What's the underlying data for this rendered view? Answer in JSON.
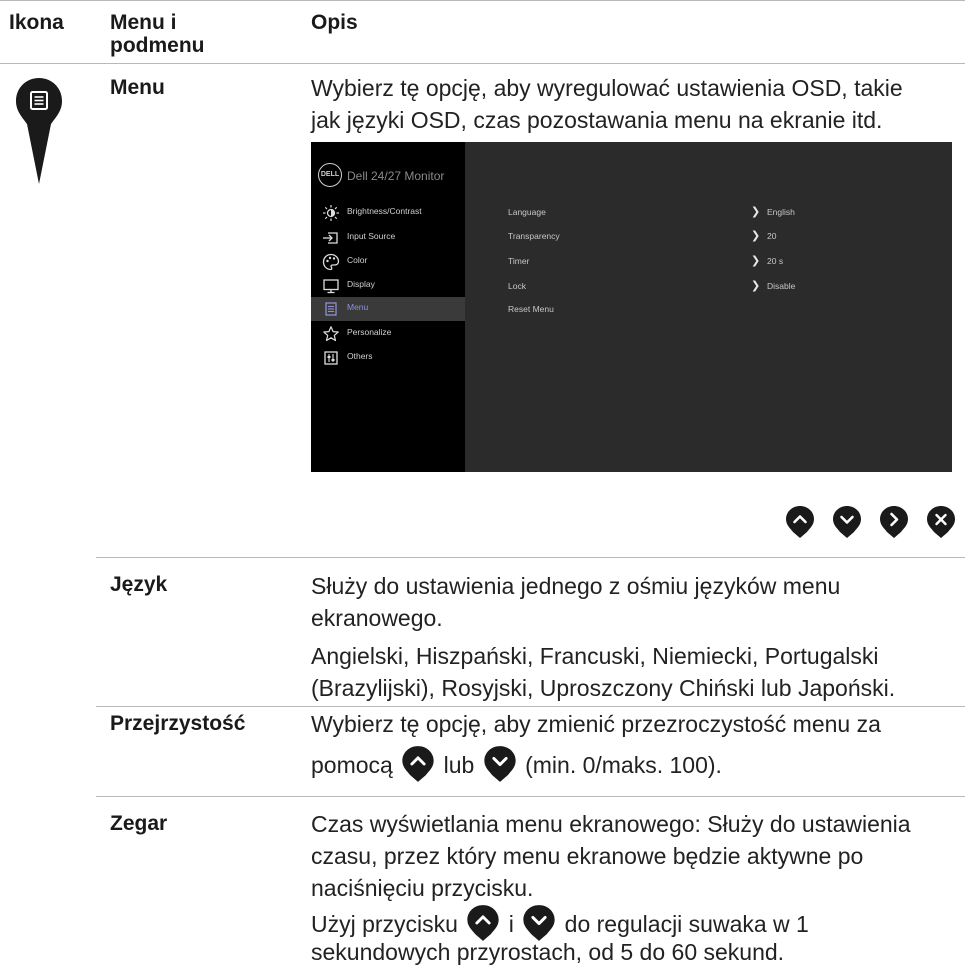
{
  "header": {
    "col_icon": "Ikona",
    "col_menu_line1": "Menu i",
    "col_menu_line2": "podmenu",
    "col_desc": "Opis"
  },
  "menu_row": {
    "term": "Menu",
    "description_line1": "Wybierz tę opcję, aby wyregulować ustawienia OSD, takie",
    "description_line2": "jak języki OSD, czas pozostawania menu na ekranie itd."
  },
  "osd": {
    "logo": "DELL",
    "title": "Dell 24/27 Monitor",
    "sidebar": [
      {
        "label": "Brightness/Contrast",
        "icon": "brightness-icon"
      },
      {
        "label": "Input Source",
        "icon": "input-source-icon"
      },
      {
        "label": "Color",
        "icon": "color-palette-icon"
      },
      {
        "label": "Display",
        "icon": "display-icon"
      },
      {
        "label": "Menu",
        "icon": "menu-icon",
        "selected": true
      },
      {
        "label": "Personalize",
        "icon": "star-icon"
      },
      {
        "label": "Others",
        "icon": "others-icon"
      }
    ],
    "settings": [
      {
        "label": "Language",
        "value": "English"
      },
      {
        "label": "Transparency",
        "value": "20"
      },
      {
        "label": "Timer",
        "value": "20 s"
      },
      {
        "label": "Lock",
        "value": "Disable"
      },
      {
        "label": "Reset Menu",
        "value": ""
      }
    ]
  },
  "nav_buttons": [
    "up-button-icon",
    "down-button-icon",
    "right-button-icon",
    "close-button-icon"
  ],
  "language": {
    "term": "Język",
    "description_line1": "Służy do ustawienia jednego z ośmiu języków menu",
    "description_line2": "ekranowego.",
    "list_line1": "Angielski, Hiszpański, Francuski, Niemiecki, Portugalski",
    "list_line2": "(Brazylijski), Rosyjski, Uproszczony Chiński lub Japoński."
  },
  "transparency": {
    "term": "Przejrzystość",
    "description_line1": "Wybierz tę opcję, aby zmienić przezroczystość menu za",
    "description_pre": "pomocą",
    "description_mid": "lub",
    "description_post": "(min. 0/maks. 100)."
  },
  "timer": {
    "term": "Zegar",
    "description_line1": "Czas wyświetlania menu ekranowego: Służy do ustawienia",
    "description_line2": "czasu, przez który menu ekranowe będzie aktywne po",
    "description_line3": "naciśnięciu przycisku.",
    "usage_pre": "Użyj przycisku",
    "usage_mid": "i",
    "usage_post": "do regulacji suwaka w 1",
    "usage_line2": "sekundowych przyrostach, od 5 do 60 sekund."
  },
  "colors": {
    "pin": "#1a1a1a",
    "osd_bg": "#2b2b2b",
    "osd_sidebar": "#000000",
    "osd_selected": "#8f8fd8",
    "rule": "#b9b9b9"
  }
}
